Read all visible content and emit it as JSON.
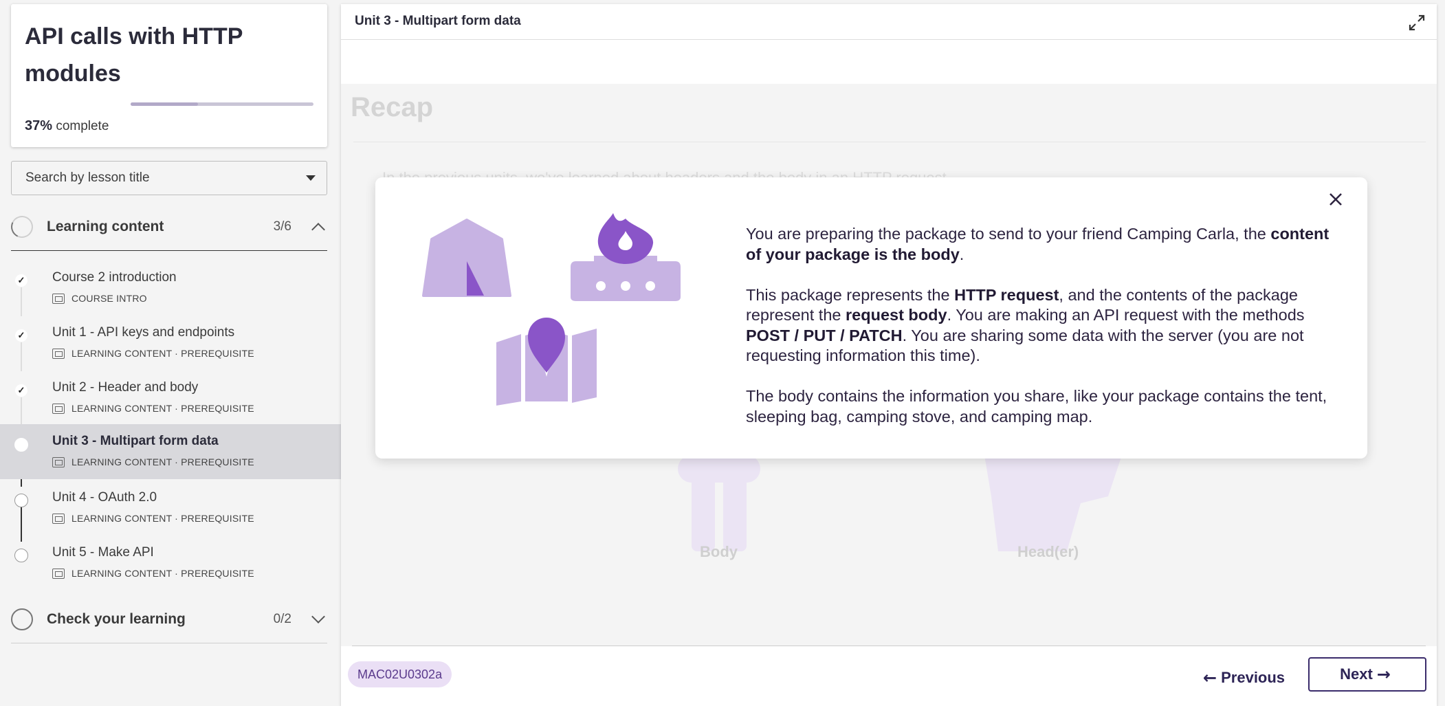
{
  "sidebar": {
    "course_title": "API calls with HTTP modules",
    "progress_percent": "37%",
    "progress_suffix": "complete",
    "progress_fraction": 0.37,
    "search_placeholder": "Search by lesson title",
    "sections": [
      {
        "label": "Learning content",
        "count": "3/6",
        "expanded": true,
        "lessons": [
          {
            "title": "Course 2 introduction",
            "meta": "COURSE INTRO",
            "status": "done"
          },
          {
            "title": "Unit 1 - API keys and endpoints",
            "meta": "LEARNING CONTENT · PREREQUISITE",
            "status": "done"
          },
          {
            "title": "Unit 2 - Header and body",
            "meta": "LEARNING CONTENT · PREREQUISITE",
            "status": "done"
          },
          {
            "title": "Unit 3 - Multipart form data",
            "meta": "LEARNING CONTENT · PREREQUISITE",
            "status": "active"
          },
          {
            "title": "Unit 4 - OAuth 2.0",
            "meta": "LEARNING CONTENT · PREREQUISITE",
            "status": "todo"
          },
          {
            "title": "Unit 5 - Make API",
            "meta": "LEARNING CONTENT · PREREQUISITE",
            "status": "todo"
          }
        ]
      },
      {
        "label": "Check your learning",
        "count": "0/2",
        "expanded": false
      }
    ]
  },
  "main": {
    "unit_title": "Unit 3 - Multipart form data",
    "recap_heading": "Recap",
    "ghost_text": "In the previous units, we've learned about headers and the body in an HTTP request.",
    "ghost_labels": [
      "Body",
      "Head(er)"
    ]
  },
  "modal": {
    "paragraph_1_a": "You are preparing the package to send to your friend Camping Carla, the ",
    "paragraph_1_b": "content of your package is the body",
    "paragraph_1_c": ".",
    "paragraph_2_a": "This package represents the ",
    "paragraph_2_b": "HTTP request",
    "paragraph_2_c": ", and the contents of the package represent the ",
    "paragraph_2_d": "request body",
    "paragraph_2_e": ". You are making an API request with the methods ",
    "paragraph_2_f": "POST / PUT / PATCH",
    "paragraph_2_g": ". You are sharing some data with the server (you are not requesting information this time).",
    "paragraph_3": "The body contains the information you share, like your package contains the tent, sleeping bag, camping stove, and camping map."
  },
  "footer": {
    "code": "MAC02U0302a",
    "previous_label": "Previous",
    "next_label": "Next"
  },
  "colors": {
    "accent_purple": "#8a55c8",
    "light_purple": "#c7b3e3",
    "text_dark": "#2d2440"
  },
  "icons": [
    "tent-icon",
    "camping-stove-icon",
    "map-icon",
    "close-icon",
    "expand-icon",
    "check-icon",
    "chevron-up-icon",
    "chevron-down-icon",
    "lesson-type-icon",
    "arrow-left-icon",
    "arrow-right-icon"
  ]
}
